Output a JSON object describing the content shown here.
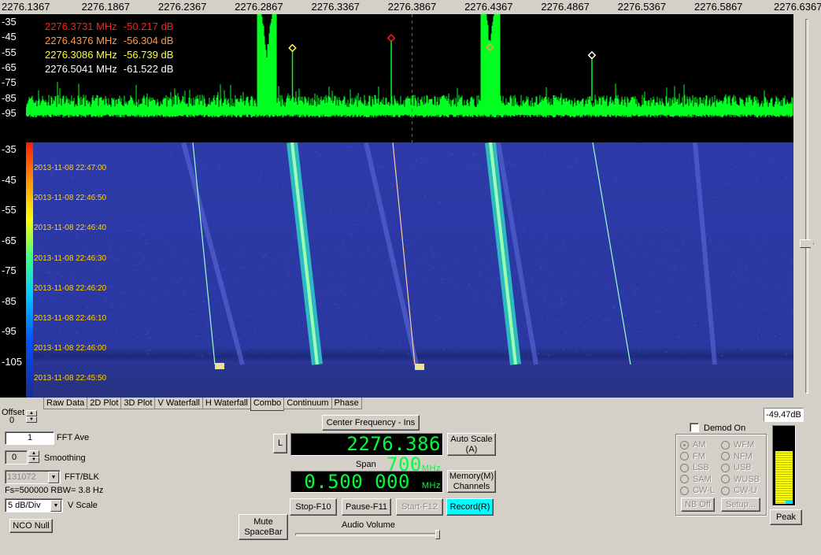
{
  "freq_axis": {
    "ticks": [
      "2276.1367",
      "2276.1867",
      "2276.2367",
      "2276.2867",
      "2276.3367",
      "2276.3867",
      "2276.4367",
      "2276.4867",
      "2276.5367",
      "2276.5867",
      "2276.6367"
    ]
  },
  "spectrum": {
    "db_ticks": [
      "-35",
      "-45",
      "-55",
      "-65",
      "-75",
      "-85",
      "-95"
    ],
    "markers": [
      {
        "freq": "2276.3731 MHz",
        "level": "-50.217 dB",
        "color": "#ff2020",
        "freq_value": 2276.3731,
        "db_value": -50.217
      },
      {
        "freq": "2276.4376 MHz",
        "level": "-56.304 dB",
        "color": "#ff9a4a",
        "freq_value": 2276.4376,
        "db_value": -56.304
      },
      {
        "freq": "2276.3086 MHz",
        "level": "-56.739 dB",
        "color": "#ffff30",
        "freq_value": 2276.3086,
        "db_value": -56.739
      },
      {
        "freq": "2276.5041 MHz",
        "level": "-61.522 dB",
        "color": "#ffffff",
        "freq_value": 2276.5041,
        "db_value": -61.522
      }
    ],
    "trace_color": "#00ff20"
  },
  "waterfall": {
    "db_ticks": [
      "-35",
      "-45",
      "-55",
      "-65",
      "-75",
      "-85",
      "-95",
      "-105"
    ],
    "timestamps": [
      "2013-11-08 22:47:00",
      "2013-11-08 22:46:50",
      "2013-11-08 22:46:40",
      "2013-11-08 22:46:30",
      "2013-11-08 22:46:20",
      "2013-11-08 22:46:10",
      "2013-11-08 22:46:00",
      "2013-11-08 22:45:50"
    ]
  },
  "tabs": [
    "Raw Data",
    "2D Plot",
    "3D Plot",
    "V Waterfall",
    "H Waterfall",
    "Combo",
    "Continuum",
    "Phase"
  ],
  "active_tab": "Combo",
  "controls": {
    "offset_label": "Offset",
    "offset_value": "0",
    "fft_ave_value": "1",
    "fft_ave_label": "FFT Ave",
    "smoothing_value": "0",
    "smoothing_label": "Smoothing",
    "fft_blk_value": "131072",
    "fft_blk_label": "FFT/BLK",
    "fs_rbw": "Fs=500000 RBW= 3.8 Hz",
    "vscale_value": "5 dB/Div",
    "vscale_label": "V Scale",
    "nco_null": "NCO Null",
    "mute": "Mute\nSpaceBar"
  },
  "center": {
    "title_button": "Center Frequency - Ins",
    "l_button": "L",
    "frequency": "2276.386 700",
    "freq_unit": "MHz",
    "auto_scale": "Auto Scale\n(A)",
    "span_label": "Span",
    "span": "0.500 000",
    "span_unit": "MHz",
    "memory": "Memory(M)\nChannels",
    "stop": "Stop-F10",
    "pause": "Pause-F11",
    "start": "Start-F12",
    "record": "Record(R)",
    "audio_volume": "Audio Volume"
  },
  "demod": {
    "label": "Demod On",
    "modes_left": [
      "AM",
      "FM",
      "LSB",
      "SAM",
      "CW-L"
    ],
    "modes_right": [
      "WFM",
      "NFM",
      "USB",
      "WUSB",
      "CW-U"
    ],
    "selected": "AM",
    "nb_off": "NB Off",
    "setup": "Setup..."
  },
  "meter": {
    "readout": "-49.47dB",
    "peak": "Peak",
    "level_fraction": 0.68
  }
}
